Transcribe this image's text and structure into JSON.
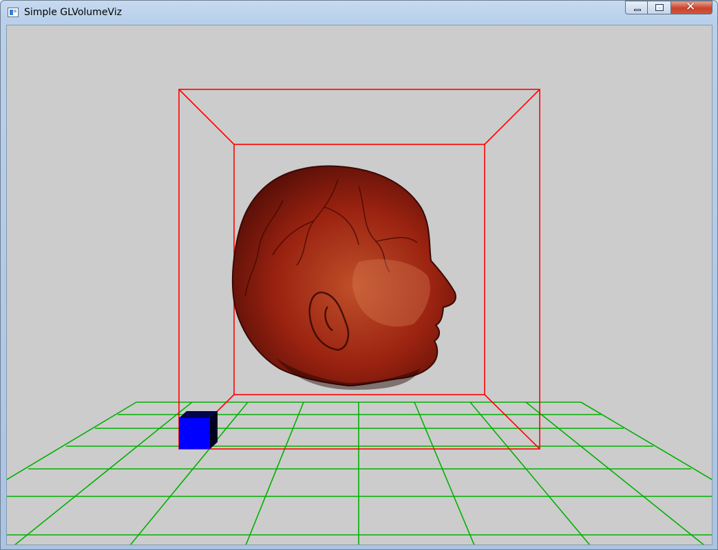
{
  "window": {
    "title": "Simple GLVolumeViz",
    "icon": "app-window-icon",
    "controls": {
      "minimize": "minimize-icon",
      "maximize": "maximize-icon",
      "close": "close-icon"
    }
  },
  "scene": {
    "background": "#cccccc",
    "grid_color": "#00b000",
    "bounding_box_color": "#ff0000",
    "cube_color": "#0000ff",
    "volume_color": "#8a1a0c",
    "volume_subject": "head"
  }
}
